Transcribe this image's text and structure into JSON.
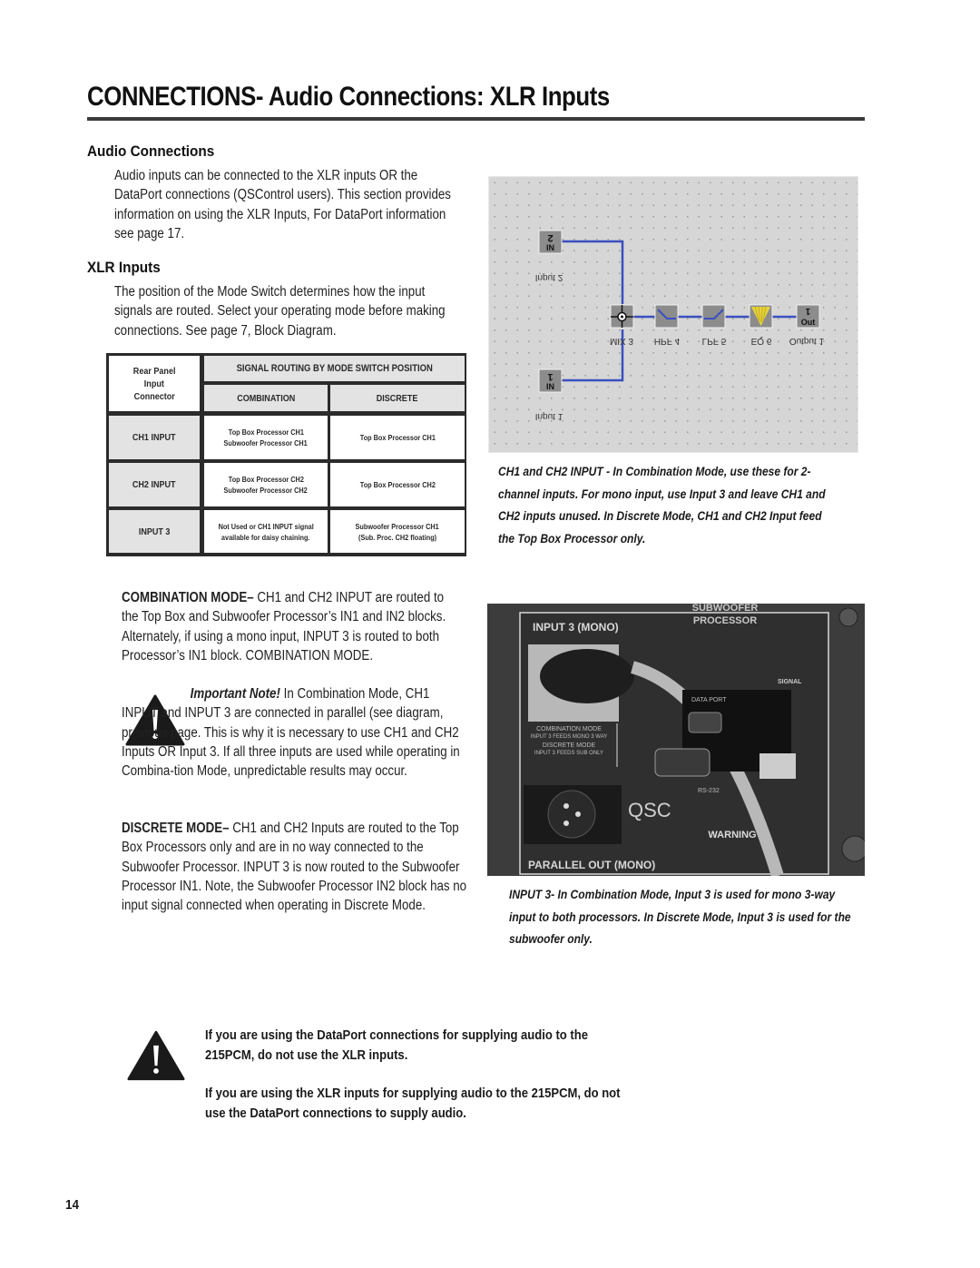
{
  "header": {
    "title": "CONNECTIONS- Audio Connections: XLR Inputs"
  },
  "sections": {
    "audio_connections": {
      "heading": "Audio Connections",
      "body": "Audio inputs can be connected to the XLR inputs OR the DataPort connections (QSControl users). This section provides information on using the XLR Inputs, For DataPort information see page 17."
    },
    "xlr_inputs": {
      "heading": "XLR Inputs",
      "body": "The position of the Mode Switch determines how the input signals are routed. Select your operating mode before making connections. See page 7, Block Diagram."
    }
  },
  "routing_table": {
    "header_connector": [
      "Rear Panel",
      "Input",
      "Connector"
    ],
    "header_group": "SIGNAL ROUTING BY MODE SWITCH POSITION",
    "columns": [
      "COMBINATION",
      "DISCRETE"
    ],
    "rows": [
      {
        "input": "CH1 INPUT",
        "combination": [
          "Top Box Processor CH1",
          "Subwoofer Processor CH1"
        ],
        "discrete": [
          "Top Box Processor CH1"
        ]
      },
      {
        "input": "CH2 INPUT",
        "combination": [
          "Top Box Processor CH2",
          "Subwoofer Processor CH2"
        ],
        "discrete": [
          "Top Box Processor CH2"
        ]
      },
      {
        "input": "INPUT 3",
        "combination": [
          "Not Used or CH1 INPUT signal",
          "available for daisy chaining."
        ],
        "discrete": [
          "Subwoofer Processor CH1",
          "(Sub. Proc. CH2 floating)"
        ]
      }
    ]
  },
  "block_diagram": {
    "blocks": [
      {
        "id": "input2",
        "label": "Input 2",
        "glyph_top": "2",
        "glyph_bottom": "IN"
      },
      {
        "id": "input1",
        "label": "Input 1",
        "glyph_top": "1",
        "glyph_bottom": "IN"
      },
      {
        "id": "mix3",
        "label": "MIX 3"
      },
      {
        "id": "hpf4",
        "label": "HPF 4"
      },
      {
        "id": "lpf5",
        "label": "LPF 5"
      },
      {
        "id": "eq6",
        "label": "EQ 6"
      },
      {
        "id": "output1",
        "label": "Output 1",
        "glyph_top": "1",
        "glyph_bottom": "Out"
      }
    ],
    "colors": {
      "wire": "#3a4fc0",
      "block": "#8c8c8c",
      "eq": "#e8d43a",
      "background": "#d6d6d6"
    },
    "caption": "CH1 and CH2 INPUT - In Combination Mode, use these for 2-channel inputs. For mono input, use Input 3 and leave CH1 and CH2 inputs unused. In Discrete Mode, CH1 and CH2 Input feed the Top Box Processor only."
  },
  "modes": {
    "combination": {
      "lead": "COMBINATION MODE–",
      "body": " CH1 and CH2 INPUT are routed to the Top Box and Subwoofer Processor’s IN1 and IN2 blocks. Alternately, if using a mono input, INPUT 3 is routed to both Processor’s IN1 block. COMBINATION MODE."
    },
    "important_note": {
      "lead": "Important Note!",
      "body": "  In Combination Mode, CH1 INPUT and INPUT 3 are connected in parallel (see diagram, previous page. This is why it is necessary to use CH1 and CH2 Inputs OR Input 3. If all three inputs are used while operating in Combina-tion Mode, unpredictable results may occur."
    },
    "discrete": {
      "lead": "DISCRETE MODE–",
      "body": " CH1 and CH2 Inputs are routed to the Top Box Processors only and are in no way connected to the Subwoofer Processor. INPUT 3 is now routed to the Subwoofer Processor IN1. Note, the Subwoofer Processor IN2 block has no input signal connected when operating in Discrete Mode."
    }
  },
  "photo": {
    "labels": {
      "input3": "INPUT 3 (MONO)",
      "sub_proc_1": "SUBWOOFER",
      "sub_proc_2": "PROCESSOR",
      "parallel_out": "PARALLEL OUT (MONO)",
      "signal": "SIGNAL",
      "data_port": "DATA PORT",
      "rs232": "RS-232",
      "warning": "WARNING",
      "combo_mode": "COMBINATION MODE",
      "combo_mode_sub": "INPUT 3 FEEDS MONO 3 WAY",
      "discrete_mode": "DISCRETE MODE",
      "discrete_mode_sub": "INPUT 3 FEEDS SUB ONLY",
      "brand": "QSC"
    },
    "caption": "INPUT 3-  In Combination Mode, Input 3 is used for mono 3-way input to both processors. In Discrete Mode, Input 3 is used for the subwoofer only."
  },
  "warnings": {
    "dataport": "If you are using the DataPort connections for supplying audio to the 215PCM, do not use the XLR inputs.",
    "xlr": "If you are using the XLR inputs for supplying audio to the 215PCM, do not use the DataPort connections to supply audio."
  },
  "footer": {
    "page_number": "14"
  }
}
